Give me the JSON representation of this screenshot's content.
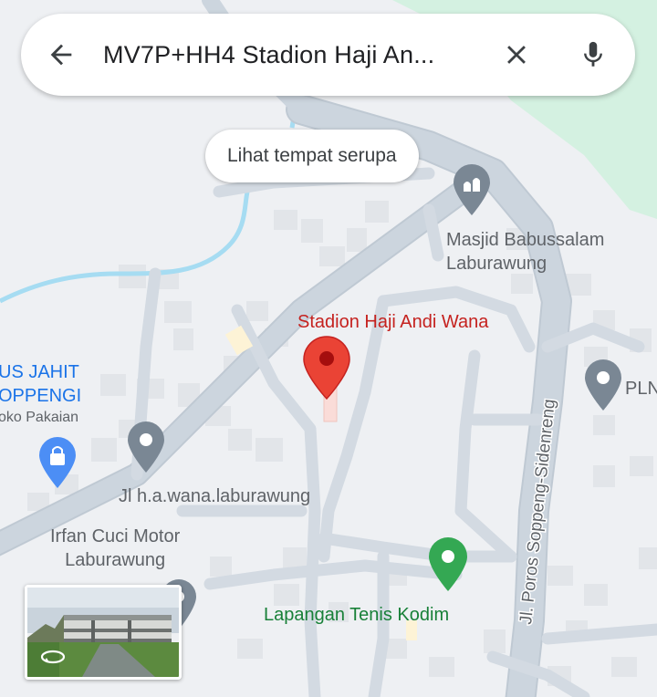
{
  "search": {
    "query": "MV7P+HH4 Stadion Haji An...",
    "back_icon": "arrow-back-icon",
    "clear_icon": "close-icon",
    "mic_icon": "microphone-icon"
  },
  "chip": {
    "label": "Lihat tempat serupa"
  },
  "places": {
    "stadium": "Stadion Haji Andi Wana",
    "mosque_line1": "Masjid Babussalam",
    "mosque_line2": "Laburawung",
    "pln": "PLN",
    "tailor_line1": "US JAHIT",
    "tailor_line2": "OPPENGI",
    "tailor_category": "oko Pakaian",
    "jl_wana": "Jl h.a.wana.laburawung",
    "carwash_line1": "Irfan Cuci Motor",
    "carwash_line2": "Laburawung",
    "tennis": "Lapangan Tenis Kodim"
  },
  "roads": {
    "poros": "Jl. Poros Soppeng-Sidenreng"
  },
  "colors": {
    "map_bg": "#eef0f3",
    "road": "#ccd5de",
    "road_edge": "#bfc9d3",
    "park": "#d4f1e1",
    "river": "#a6dcf2",
    "pin_red": "#ea4335",
    "pin_gray": "#7a8794",
    "pin_green": "#34a853",
    "pin_blue": "#4c8ef5"
  }
}
